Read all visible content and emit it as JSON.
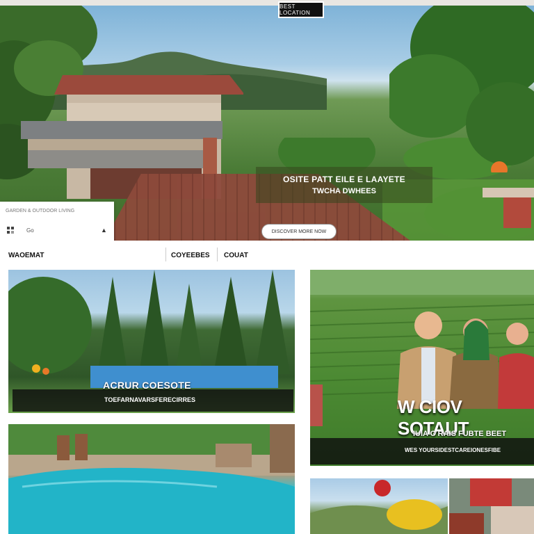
{
  "header": {
    "logo_text": "BEST LOCATION"
  },
  "hero": {
    "caption_line1": "OSITE PATT EILE E LAAYETE",
    "caption_line2": "TWCHA DWHEES",
    "cta_label": "DISCOVER MORE NOW",
    "side_card": {
      "title": "GARDEN & OUTDOOR LIVING",
      "label": "Go",
      "caret": "▲"
    }
  },
  "nav": {
    "left_label": "WAOEMAT",
    "item_a": "COYEEBES",
    "item_b": "COUAT"
  },
  "cards": {
    "card1": {
      "title": "ACRUR COESOTE",
      "subtitle": "TOEFARNAVARSFERECIRRES"
    },
    "card2": {
      "title": "W CIOV SOTAUT",
      "subtitle1": "IUIA C RAIS FUBTE BEET",
      "subtitle2": "WES YOURSIDESTCAREIONESFIBE"
    }
  },
  "colors": {
    "caption_bg": "#0f0f0f",
    "roof": "#9b4a3c",
    "grass": "#4c8a33",
    "pool": "#1aa8c0"
  },
  "icons": [
    "logo-icon",
    "location-icon",
    "caret-up-icon"
  ]
}
